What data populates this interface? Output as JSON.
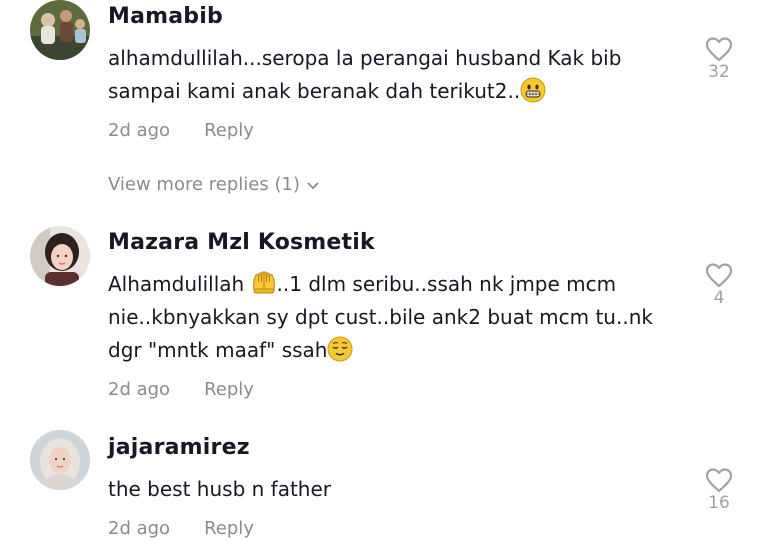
{
  "comments": [
    {
      "username": "Mamabib",
      "text_parts": [
        "alhamdullilah...seropa la perangai husband Kak bib",
        "sampai kami anak beranak dah terikut2.."
      ],
      "emoji": "grinning-face-emoji",
      "time": "2d ago",
      "reply_label": "Reply",
      "likes": "32"
    },
    {
      "username": "Mazara Mzl Kosmetik",
      "text_parts": [
        "Alhamdulillah ",
        "..1 dlm seribu..ssah nk jmpe mcm",
        "nie..kbnyakkan sy dpt cust..bile ank2 buat mcm tu..nk",
        "dgr \"mntk maaf\" ssah"
      ],
      "emoji_inline": "open-hands-emoji",
      "emoji_end": "relieved-face-emoji",
      "time": "2d ago",
      "reply_label": "Reply",
      "likes": "4"
    },
    {
      "username": "jajaramirez",
      "text": "the best husb n father",
      "time": "2d ago",
      "reply_label": "Reply",
      "likes": "16"
    }
  ],
  "more_replies": "View more replies (1)",
  "colors": {
    "text": "#161823",
    "meta": "#8a8b91",
    "icon": "#a1a2a7",
    "emoji": "#f7c82f"
  }
}
